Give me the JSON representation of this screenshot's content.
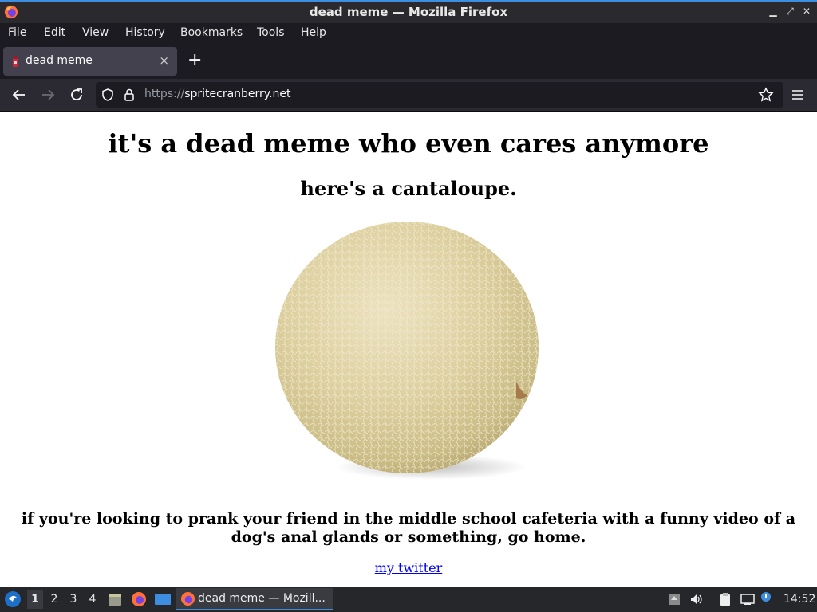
{
  "window": {
    "title": "dead meme — Mozilla Firefox"
  },
  "menu": [
    "File",
    "Edit",
    "View",
    "History",
    "Bookmarks",
    "Tools",
    "Help"
  ],
  "tab": {
    "label": "dead meme",
    "close": "×",
    "new_tab": "+"
  },
  "navbar": {
    "url_scheme": "https://",
    "url_host": "spritecranberry.net"
  },
  "page": {
    "heading": "it's a dead meme who even cares anymore",
    "subheading": "here's a cantaloupe.",
    "paragraph": "if you're looking to prank your friend in the middle school cafeteria with a funny video of a dog's anal glands or something, go home.",
    "link_text": "my twitter"
  },
  "taskbar": {
    "workspaces": [
      "1",
      "2",
      "3",
      "4"
    ],
    "task_label": "dead meme — Mozill...",
    "clock": "14:52"
  },
  "colors": {
    "accent": "#3d8ee0",
    "link": "#0000ee"
  }
}
